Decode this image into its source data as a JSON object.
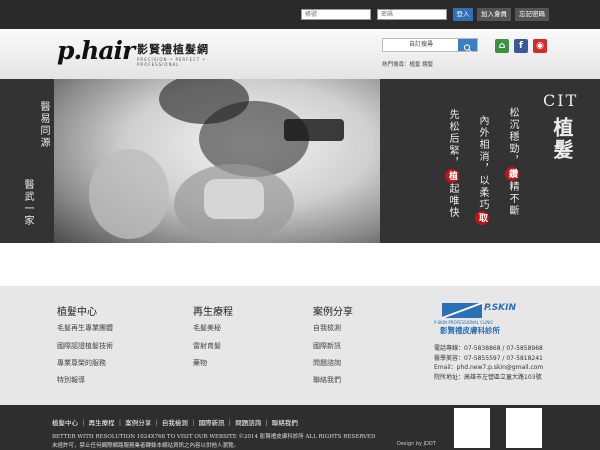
{
  "topbar": {
    "account_placeholder": "帳號",
    "password_placeholder": "密碼",
    "login": "登入",
    "join": "加入會員",
    "forgot": "忘記密碼"
  },
  "header": {
    "logo_mark": "p.hair",
    "logo_name": "影賢禮植髮網",
    "logo_tagline": "PRECISION • PERFECT • PROFESSIONAL",
    "search_text": "自訂搜尋",
    "hot_label": "熱門搜尋：",
    "hot_terms": "植髮 鏡髮",
    "social": [
      {
        "name": "home-icon",
        "glyph": "⌂",
        "color": "#3e8f3e"
      },
      {
        "name": "facebook-icon",
        "glyph": "f",
        "color": "#3b5998"
      },
      {
        "name": "weibo-icon",
        "glyph": "◉",
        "color": "#d52b2b"
      }
    ]
  },
  "banner": {
    "left_col1": "醫易同源",
    "left_col2": "醫武一家",
    "brand": "CIT",
    "brand_word": "植髮",
    "slogan": [
      {
        "pre": "松沉穩勁，",
        "mark": "鑽",
        "post": "精不斷"
      },
      {
        "pre": "內外相消，以柔巧",
        "mark": "取",
        "post": ""
      },
      {
        "pre": "先松后緊，",
        "mark": "植",
        "post": "起唯快"
      }
    ]
  },
  "links": {
    "columns": [
      {
        "title": "植髮中心",
        "items": [
          "毛髮再生專業團體",
          "國際認證植髮技術",
          "專業尊榮的服務",
          "特別報導"
        ]
      },
      {
        "title": "再生療程",
        "items": [
          "毛髮美秘",
          "雷射育髮",
          "藥物"
        ]
      },
      {
        "title": "案例分享",
        "items": [
          "自我檢測",
          "國際新訊",
          "問題諮詢",
          "聯絡我們"
        ]
      }
    ],
    "clinic": {
      "logo": "P.SKIN",
      "logo_sub": "P-SKIN PROFESSIONAL CLINIC",
      "name": "影賢禮皮膚科診所",
      "phone": "電話專線：07-5838868 / 07-5858968",
      "beauty": "醫學美容：07-5855597 / 07-5818241",
      "email": "Email：phd.new7.p.skin@gmail.com",
      "address": "院所地址：高雄市左營區立童大路103號"
    }
  },
  "footer": {
    "nav": [
      "植髮中心",
      "再生療程",
      "案例分享",
      "自我檢測",
      "國際新訊",
      "問題諮詢",
      "聯絡我們"
    ],
    "line1": "BETTER WITH RESOLUTION 1024X768 TO VISIT OUR WEBSITE ©2014 影賢禮皮膚科診所 ALL RIGHTS RESERVED",
    "line2": "未經許可，禁止任何網際網路服務業者轉錄本網站資訊之內容以供他人瀏覽。",
    "credit": "Design by JDDT"
  }
}
